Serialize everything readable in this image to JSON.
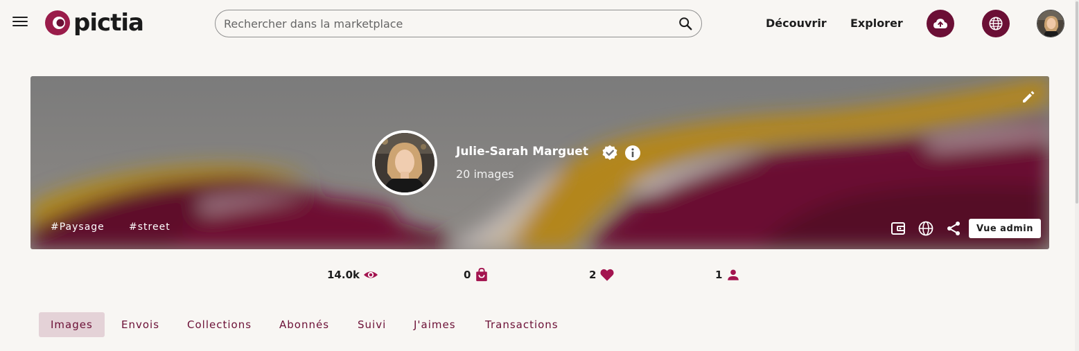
{
  "brand": {
    "name": "pictia",
    "color": "#6b0f35"
  },
  "search": {
    "placeholder": "Rechercher dans la marketplace",
    "value": ""
  },
  "nav": {
    "discover": "Découvrir",
    "explore": "Explorer",
    "upload_icon": "cloud-upload-icon",
    "language_icon": "globe-icon"
  },
  "profile": {
    "name": "Julie-Sarah Marguet",
    "image_count": "20 images",
    "tags": [
      "#Paysage",
      "#street"
    ],
    "admin_button": "Vue admin"
  },
  "stats": [
    {
      "value": "14.0k",
      "icon": "eye-icon"
    },
    {
      "value": "0",
      "icon": "shopping-bag-icon"
    },
    {
      "value": "2",
      "icon": "heart-icon"
    },
    {
      "value": "1",
      "icon": "person-icon"
    }
  ],
  "tabs": [
    {
      "label": "Images",
      "active": true
    },
    {
      "label": "Envois",
      "active": false
    },
    {
      "label": "Collections",
      "active": false
    },
    {
      "label": "Abonnés",
      "active": false
    },
    {
      "label": "Suivi",
      "active": false
    },
    {
      "label": "J'aimes",
      "active": false
    },
    {
      "label": "Transactions",
      "active": false
    }
  ],
  "colors": {
    "accent": "#6b0f35",
    "stat_icon": "#a3144f",
    "tab_active_bg": "#e4d2d7",
    "page_bg": "#f8f6f3"
  }
}
